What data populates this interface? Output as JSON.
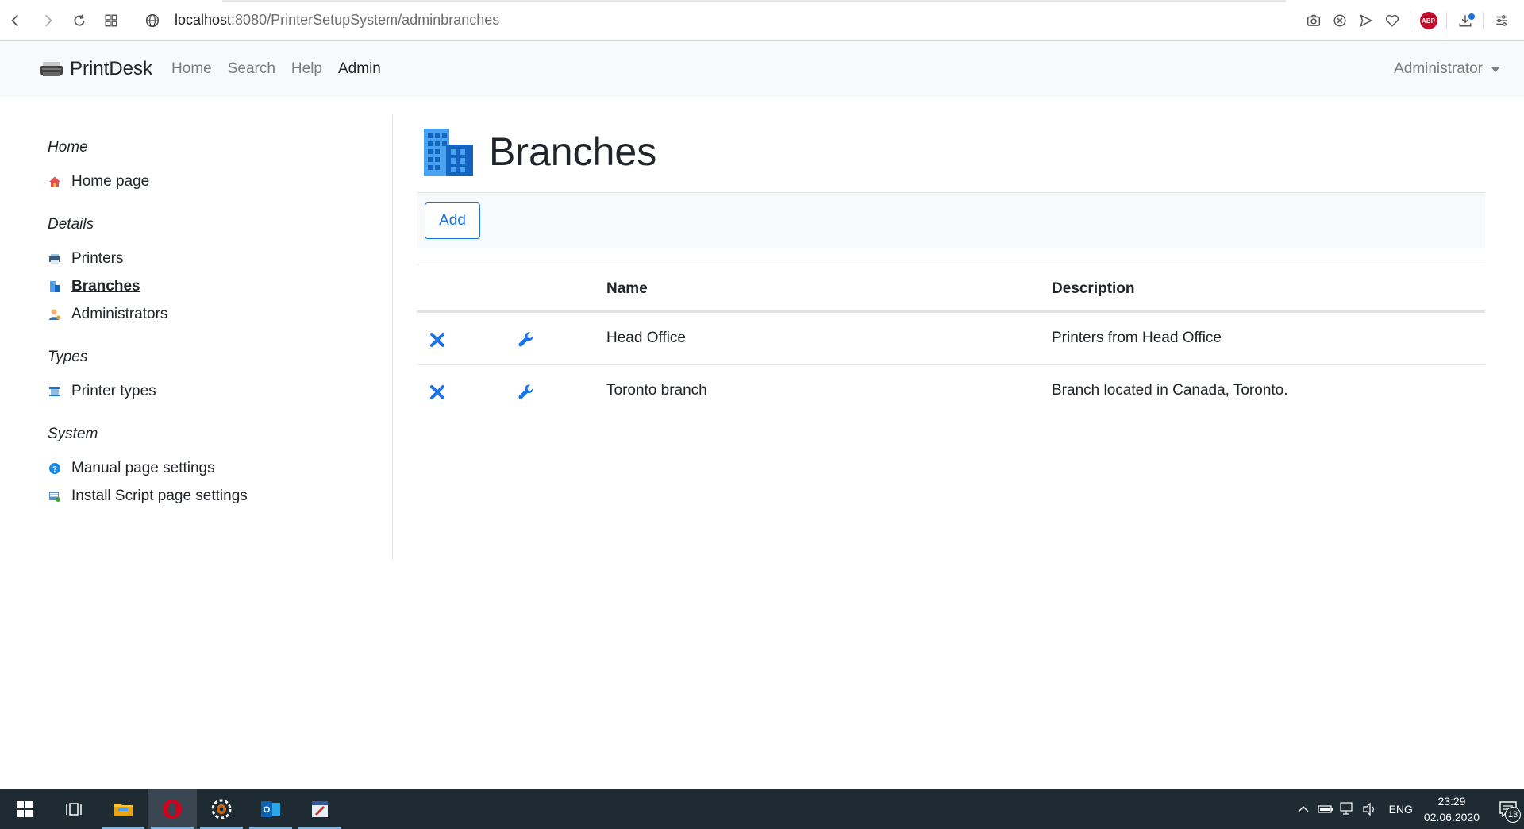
{
  "browser": {
    "url_host": "localhost",
    "url_path": ":8080/PrinterSetupSystem/adminbranches"
  },
  "navbar": {
    "brand": "PrintDesk",
    "links": [
      {
        "label": "Home"
      },
      {
        "label": "Search"
      },
      {
        "label": "Help"
      },
      {
        "label": "Admin"
      }
    ],
    "user": "Administrator"
  },
  "sidebar": {
    "sections": [
      {
        "title": "Home",
        "items": [
          {
            "label": "Home page",
            "icon": "home-icon"
          }
        ]
      },
      {
        "title": "Details",
        "items": [
          {
            "label": "Printers",
            "icon": "printer-icon"
          },
          {
            "label": "Branches",
            "icon": "building-icon"
          },
          {
            "label": "Administrators",
            "icon": "admin-user-icon"
          }
        ]
      },
      {
        "title": "Types",
        "items": [
          {
            "label": "Printer types",
            "icon": "printer-type-icon"
          }
        ]
      },
      {
        "title": "System",
        "items": [
          {
            "label": "Manual page settings",
            "icon": "help-circle-icon"
          },
          {
            "label": "Install Script page settings",
            "icon": "script-settings-icon"
          }
        ]
      }
    ]
  },
  "main": {
    "title": "Branches",
    "add_label": "Add",
    "columns": {
      "name": "Name",
      "description": "Description"
    },
    "rows": [
      {
        "name": "Head Office",
        "description": "Printers from Head Office"
      },
      {
        "name": "Toronto branch",
        "description": "Branch located in Canada, Toronto."
      }
    ]
  },
  "taskbar": {
    "lang": "ENG",
    "time": "23:29",
    "date": "02.06.2020",
    "notifications": "13"
  },
  "colors": {
    "accent": "#1a73e8",
    "navbar_bg": "#f8f9fa",
    "taskbar_bg": "#1f2b33",
    "opera_red": "#d0021b"
  }
}
